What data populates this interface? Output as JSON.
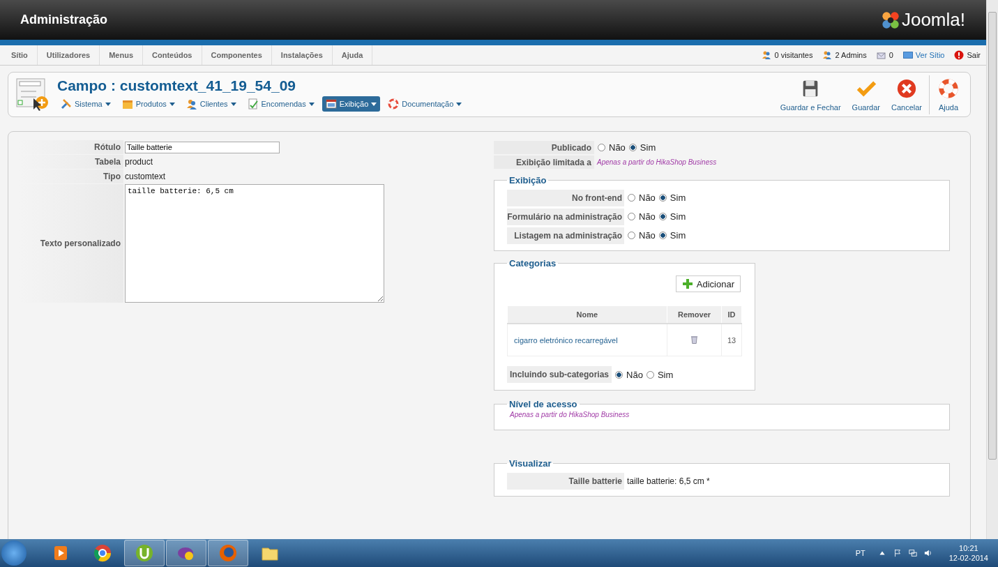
{
  "header": {
    "title": "Administração",
    "logo": "Joomla!"
  },
  "menu": [
    {
      "label": "Sítio"
    },
    {
      "label": "Utilizadores"
    },
    {
      "label": "Menus"
    },
    {
      "label": "Conteúdos"
    },
    {
      "label": "Componentes"
    },
    {
      "label": "Instalações"
    },
    {
      "label": "Ajuda"
    }
  ],
  "status": [
    {
      "kind": "users",
      "label": "0 visitantes"
    },
    {
      "kind": "users",
      "label": "2 Admins"
    },
    {
      "kind": "mail",
      "label": "0"
    },
    {
      "kind": "site",
      "label": "Ver Sítio"
    },
    {
      "kind": "logout",
      "label": "Sair"
    }
  ],
  "toolbar": {
    "title": "Campo : customtext_41_19_54_09",
    "submenu": [
      {
        "kind": "tools",
        "label": "Sistema",
        "selected": false
      },
      {
        "kind": "box",
        "label": "Produtos",
        "selected": false
      },
      {
        "kind": "users",
        "label": "Clientes",
        "selected": false
      },
      {
        "kind": "orders",
        "label": "Encomendas",
        "selected": false
      },
      {
        "kind": "display",
        "label": "Exibição",
        "selected": true
      },
      {
        "kind": "help",
        "label": "Documentação",
        "selected": false
      }
    ],
    "buttons": [
      {
        "kind": "save-close",
        "label": "Guardar e Fechar"
      },
      {
        "kind": "save",
        "label": "Guardar"
      },
      {
        "kind": "cancel",
        "label": "Cancelar"
      },
      {
        "kind": "help",
        "label": "Ajuda"
      }
    ]
  },
  "left_fields": [
    {
      "label": "Rótulo",
      "kind": "input",
      "value": "Taille batterie"
    },
    {
      "label": "Tabela",
      "kind": "text",
      "value": "product"
    },
    {
      "label": "Tipo",
      "kind": "text",
      "value": "customtext"
    },
    {
      "label": "Texto personalizado",
      "kind": "textarea",
      "value": "taille batterie: 6,5 cm"
    }
  ],
  "published": {
    "label": "Publicado",
    "options": [
      {
        "label": "Não",
        "selected": false
      },
      {
        "label": "Sim",
        "selected": true
      }
    ]
  },
  "display_limited": {
    "label": "Exibição limitada a",
    "note": "Apenas a partir do HikaShop Business"
  },
  "display": {
    "legend": "Exibição",
    "rows": [
      {
        "label": "No front-end",
        "options": [
          {
            "label": "Não",
            "selected": false
          },
          {
            "label": "Sim",
            "selected": true
          }
        ]
      },
      {
        "label": "Formulário na administração",
        "options": [
          {
            "label": "Não",
            "selected": false
          },
          {
            "label": "Sim",
            "selected": true
          }
        ]
      },
      {
        "label": "Listagem na administração",
        "options": [
          {
            "label": "Não",
            "selected": false
          },
          {
            "label": "Sim",
            "selected": true
          }
        ]
      }
    ]
  },
  "categories": {
    "legend": "Categorias",
    "add_button": "Adicionar",
    "columns": [
      "Nome",
      "Remover",
      "ID"
    ],
    "rows": [
      {
        "name": "cigarro eletrónico recarregável",
        "id": "13"
      }
    ],
    "subcategories": {
      "label": "Incluindo sub-categorias",
      "options": [
        {
          "label": "Não",
          "selected": true
        },
        {
          "label": "Sim",
          "selected": false
        }
      ]
    }
  },
  "access": {
    "legend": "Nível de acesso",
    "note": "Apenas a partir do HikaShop Business"
  },
  "preview": {
    "legend": "Visualizar",
    "label": "Taille batterie",
    "value": "taille batterie: 6,5 cm *"
  },
  "taskbar": {
    "apps": [
      {
        "kind": "media",
        "open": false
      },
      {
        "kind": "chrome",
        "open": false
      },
      {
        "kind": "torrent",
        "open": true
      },
      {
        "kind": "messenger",
        "open": true
      },
      {
        "kind": "firefox",
        "open": true
      },
      {
        "kind": "folder",
        "open": false
      }
    ],
    "language": "PT",
    "time": "10:21",
    "date": "12-02-2014"
  }
}
